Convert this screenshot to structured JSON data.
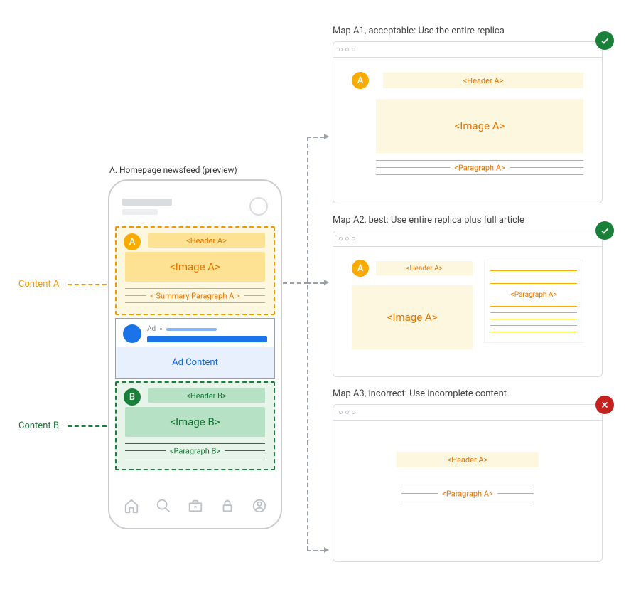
{
  "left": {
    "caption": "A. Homepage newsfeed (preview)",
    "content_a_label": "Content A",
    "content_b_label": "Content B",
    "header_a": "<Header A>",
    "image_a": "<Image A>",
    "summary_a": "< Summary Paragraph A >",
    "header_b": "<Header B>",
    "image_b": "<Image B>",
    "paragraph_b": "<Paragraph B>",
    "ad_label": "Ad",
    "ad_content": "Ad Content"
  },
  "right": {
    "b1": {
      "caption": "Map A1, acceptable: Use the entire replica",
      "header_a": "<Header A>",
      "image_a": "<Image A>",
      "paragraph_a": "<Paragraph A>",
      "status": "ok"
    },
    "b2": {
      "caption": "Map A2, best: Use entire replica plus full article",
      "header_a": "<Header A>",
      "image_a": "<Image A>",
      "paragraph_a": "<Paragraph A>",
      "status": "ok"
    },
    "b3": {
      "caption": "Map A3, incorrect: Use incomplete content",
      "header_a": "<Header A>",
      "paragraph_a": "<Paragraph A>",
      "status": "error"
    }
  },
  "badges": {
    "a": "A",
    "b": "B"
  },
  "colors": {
    "orange": "#f29900",
    "orange_text": "#e37400",
    "orange_fill": "#fef7e0",
    "orange_mid": "#fde293",
    "green": "#188038",
    "green_fill": "#e6f4ea",
    "green_mid": "#b7e1c4",
    "blue": "#1a73e8",
    "blue_fill": "#e8f0fe",
    "red": "#c5221f",
    "gray": "#9aa0a6"
  }
}
